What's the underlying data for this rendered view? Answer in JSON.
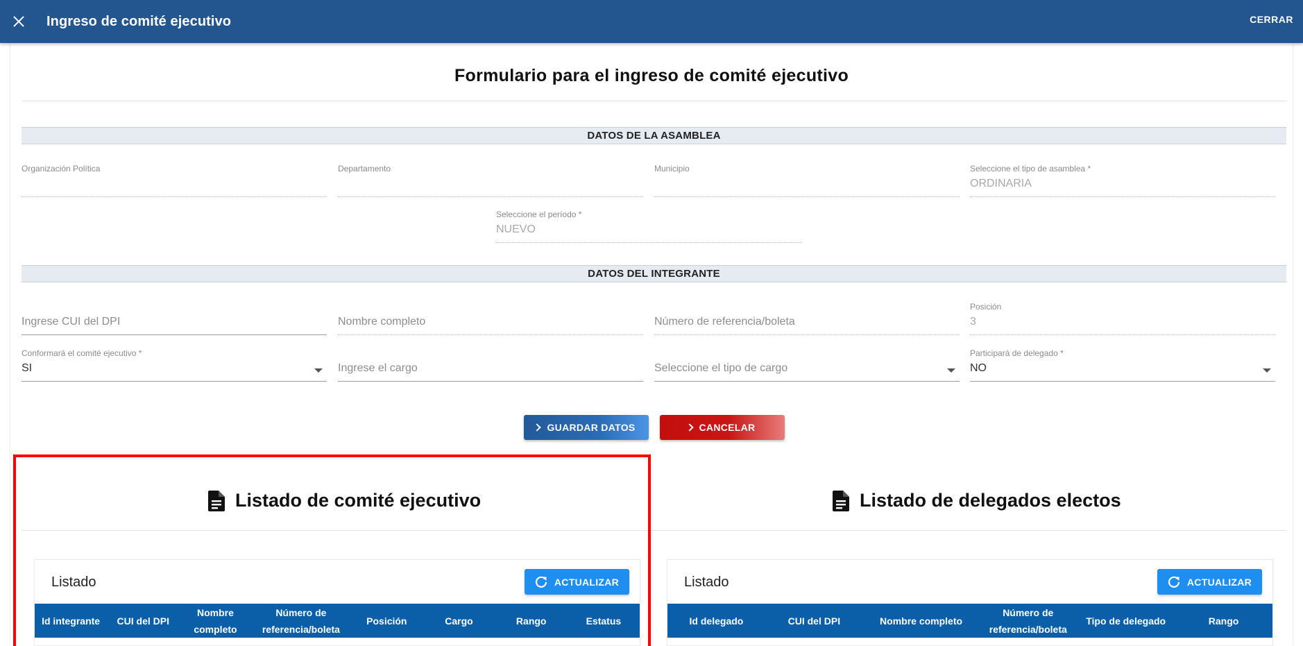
{
  "topbar": {
    "title": "Ingreso de comité ejecutivo",
    "close_label": "CERRAR"
  },
  "form": {
    "title": "Formulario para el ingreso de comité ejecutivo",
    "section_asamblea": "DATOS DE LA ASAMBLEA",
    "section_integrante": "DATOS DEL INTEGRANTE",
    "organizacion": {
      "label": "Organización Política",
      "value": ""
    },
    "departamento": {
      "label": "Departamento",
      "value": ""
    },
    "municipio": {
      "label": "Municipio",
      "value": ""
    },
    "tipo_asamblea": {
      "label": "Seleccione el tipo de asamblea *",
      "value": "ORDINARIA"
    },
    "periodo": {
      "label": "Seleccione el período *",
      "value": "NUEVO"
    },
    "cui": {
      "placeholder": "Ingrese CUI del DPI"
    },
    "nombre": {
      "placeholder": "Nombre completo"
    },
    "referencia": {
      "placeholder": "Número de referencia/boleta"
    },
    "posicion": {
      "label": "Posición",
      "value": "3"
    },
    "conformara": {
      "label": "Conformará el comité ejecutivo *",
      "value": "SI"
    },
    "cargo": {
      "placeholder": "Ingrese el cargo"
    },
    "tipo_cargo": {
      "placeholder": "Seleccione el tipo de cargo"
    },
    "delegado": {
      "label": "Participará de delegado *",
      "value": "NO"
    },
    "save_label": "GUARDAR DATOS",
    "cancel_label": "CANCELAR"
  },
  "comite": {
    "title": "Listado de comité ejecutivo",
    "list_title": "Listado",
    "refresh_label": "ACTUALIZAR",
    "columns": [
      "Id integrante",
      "CUI del DPI",
      "Nombre completo",
      "Número de referencia/boleta",
      "Posición",
      "Cargo",
      "Rango",
      "Estatus"
    ]
  },
  "delegados": {
    "title": "Listado de delegados electos",
    "list_title": "Listado",
    "refresh_label": "ACTUALIZAR",
    "columns": [
      "Id delegado",
      "CUI del DPI",
      "Nombre completo",
      "Número de referencia/boleta",
      "Tipo de delegado",
      "Rango"
    ]
  },
  "colors": {
    "topbar": "#23568f",
    "table_header": "#0b5fa8",
    "refresh": "#1f8ef1",
    "cancel": "#c40e0e",
    "highlight": "#ff0000"
  },
  "icons": {
    "close": "close-icon",
    "document": "document-icon",
    "refresh": "refresh-icon",
    "chevron": "chevron-right-icon",
    "dropdown": "caret-down-icon"
  }
}
